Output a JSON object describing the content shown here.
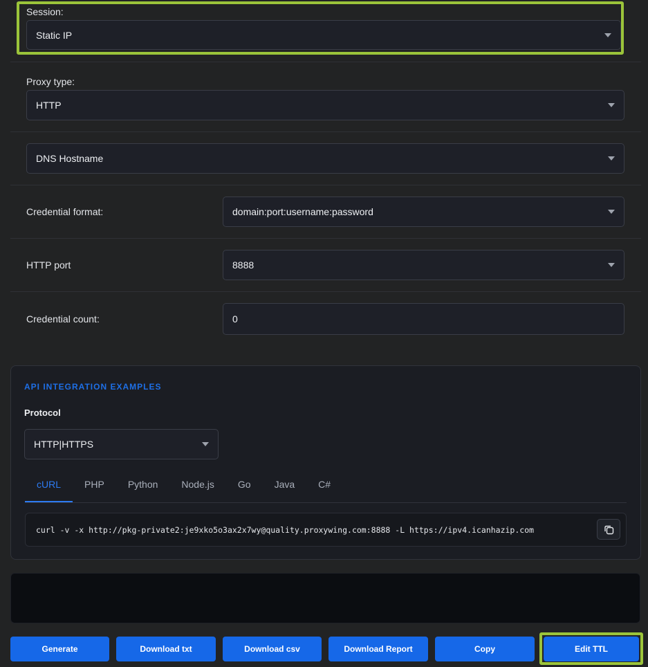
{
  "session": {
    "label": "Session:",
    "value": "Static IP"
  },
  "proxy_type": {
    "label": "Proxy type:",
    "value": "HTTP"
  },
  "dns": {
    "value": "DNS Hostname"
  },
  "credential_format": {
    "label": "Credential format:",
    "value": "domain:port:username:password"
  },
  "http_port": {
    "label": "HTTP port",
    "value": "8888"
  },
  "credential_count": {
    "label": "Credential count:",
    "value": "0"
  },
  "api": {
    "title": "API INTEGRATION EXAMPLES",
    "protocol_label": "Protocol",
    "protocol_value": "HTTP|HTTPS",
    "tabs": [
      "cURL",
      "PHP",
      "Python",
      "Node.js",
      "Go",
      "Java",
      "C#"
    ],
    "active_tab": "cURL",
    "code": "curl -v -x http://pkg-private2:je9xko5o3ax2x7wy@quality.proxywing.com:8888 -L https://ipv4.icanhazip.com"
  },
  "buttons": {
    "generate": "Generate",
    "download_txt": "Download txt",
    "download_csv": "Download csv",
    "download_report": "Download Report",
    "copy": "Copy",
    "edit_ttl": "Edit TTL"
  },
  "colors": {
    "accent": "#1668e8",
    "highlight": "#9bc43a",
    "background": "#222324"
  }
}
